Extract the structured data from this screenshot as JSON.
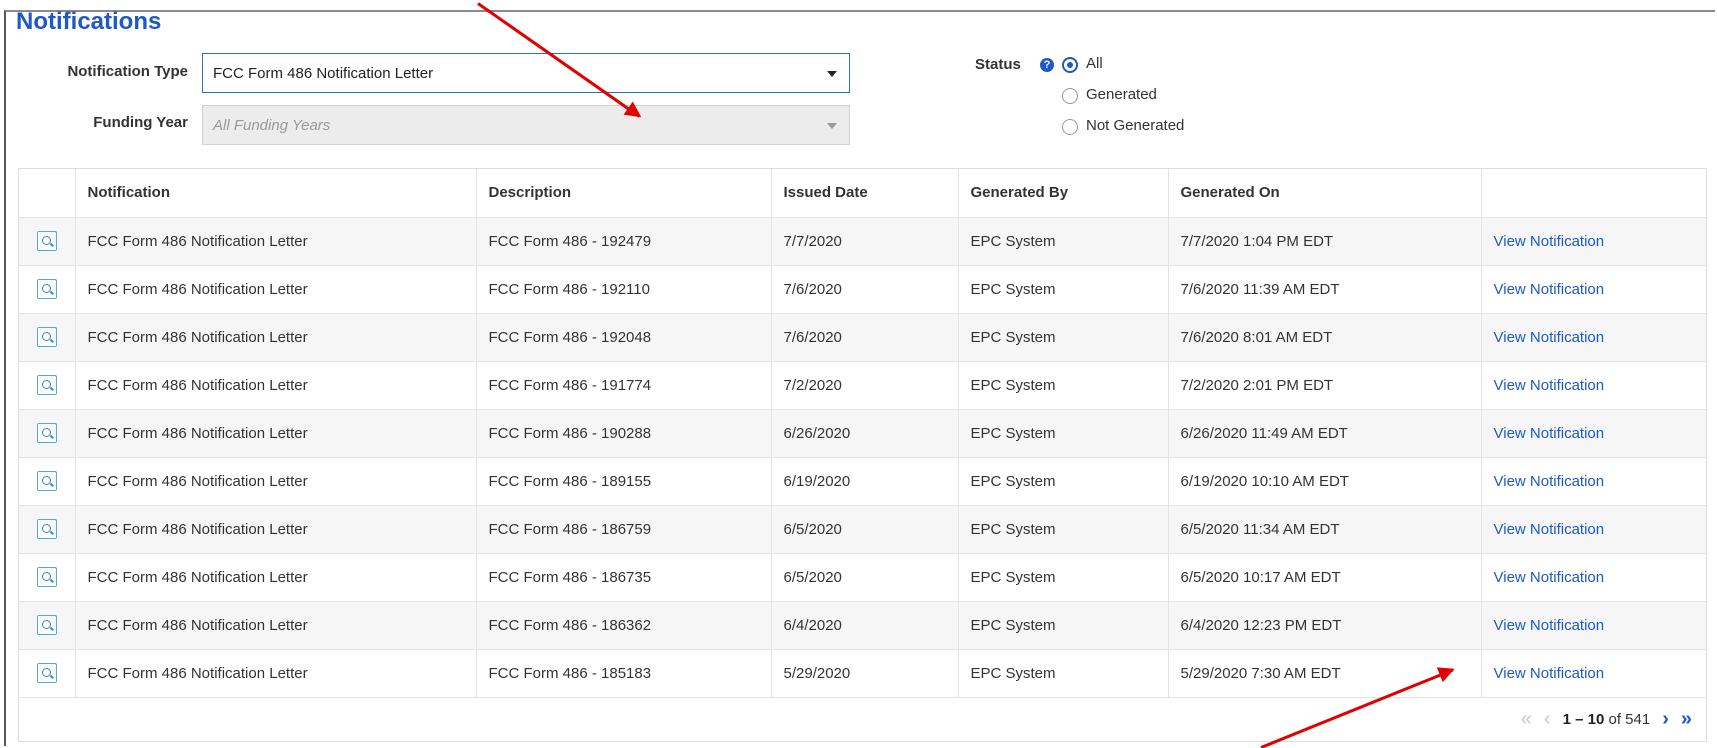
{
  "page": {
    "title": "Notifications"
  },
  "filters": {
    "notification_type_label": "Notification Type",
    "notification_type_value": "FCC Form 486 Notification Letter",
    "funding_year_label": "Funding Year",
    "funding_year_value": "All Funding Years"
  },
  "status": {
    "label": "Status",
    "help_glyph": "?",
    "options": [
      "All",
      "Generated",
      "Not Generated"
    ],
    "selected": "All"
  },
  "table": {
    "headers": [
      "Notification",
      "Description",
      "Issued Date",
      "Generated By",
      "Generated On"
    ],
    "rows": [
      {
        "notification": "FCC Form 486 Notification Letter",
        "description": "FCC Form 486 - 192479",
        "issued": "7/7/2020",
        "by": "EPC System",
        "on": "7/7/2020 1:04 PM EDT",
        "link": "View Notification"
      },
      {
        "notification": "FCC Form 486 Notification Letter",
        "description": "FCC Form 486 - 192110",
        "issued": "7/6/2020",
        "by": "EPC System",
        "on": "7/6/2020 11:39 AM EDT",
        "link": "View Notification"
      },
      {
        "notification": "FCC Form 486 Notification Letter",
        "description": "FCC Form 486 - 192048",
        "issued": "7/6/2020",
        "by": "EPC System",
        "on": "7/6/2020 8:01 AM EDT",
        "link": "View Notification"
      },
      {
        "notification": "FCC Form 486 Notification Letter",
        "description": "FCC Form 486 - 191774",
        "issued": "7/2/2020",
        "by": "EPC System",
        "on": "7/2/2020 2:01 PM EDT",
        "link": "View Notification"
      },
      {
        "notification": "FCC Form 486 Notification Letter",
        "description": "FCC Form 486 - 190288",
        "issued": "6/26/2020",
        "by": "EPC System",
        "on": "6/26/2020 11:49 AM EDT",
        "link": "View Notification"
      },
      {
        "notification": "FCC Form 486 Notification Letter",
        "description": "FCC Form 486 - 189155",
        "issued": "6/19/2020",
        "by": "EPC System",
        "on": "6/19/2020 10:10 AM EDT",
        "link": "View Notification"
      },
      {
        "notification": "FCC Form 486 Notification Letter",
        "description": "FCC Form 486 - 186759",
        "issued": "6/5/2020",
        "by": "EPC System",
        "on": "6/5/2020 11:34 AM EDT",
        "link": "View Notification"
      },
      {
        "notification": "FCC Form 486 Notification Letter",
        "description": "FCC Form 486 - 186735",
        "issued": "6/5/2020",
        "by": "EPC System",
        "on": "6/5/2020 10:17 AM EDT",
        "link": "View Notification"
      },
      {
        "notification": "FCC Form 486 Notification Letter",
        "description": "FCC Form 486 - 186362",
        "issued": "6/4/2020",
        "by": "EPC System",
        "on": "6/4/2020 12:23 PM EDT",
        "link": "View Notification"
      },
      {
        "notification": "FCC Form 486 Notification Letter",
        "description": "FCC Form 486 - 185183",
        "issued": "5/29/2020",
        "by": "EPC System",
        "on": "5/29/2020 7:30 AM EDT",
        "link": "View Notification"
      }
    ]
  },
  "pagination": {
    "first_glyph": "«",
    "prev_glyph": "‹",
    "range": "1 – 10",
    "of_text": "of",
    "total": "541",
    "next_glyph": "›",
    "last_glyph": "»"
  },
  "icons": {
    "row_view": "magnifier-icon"
  },
  "colors": {
    "accent": "#1f59c6",
    "annotation_arrow": "#e00000",
    "row_stripe": "#f6f6f6"
  }
}
